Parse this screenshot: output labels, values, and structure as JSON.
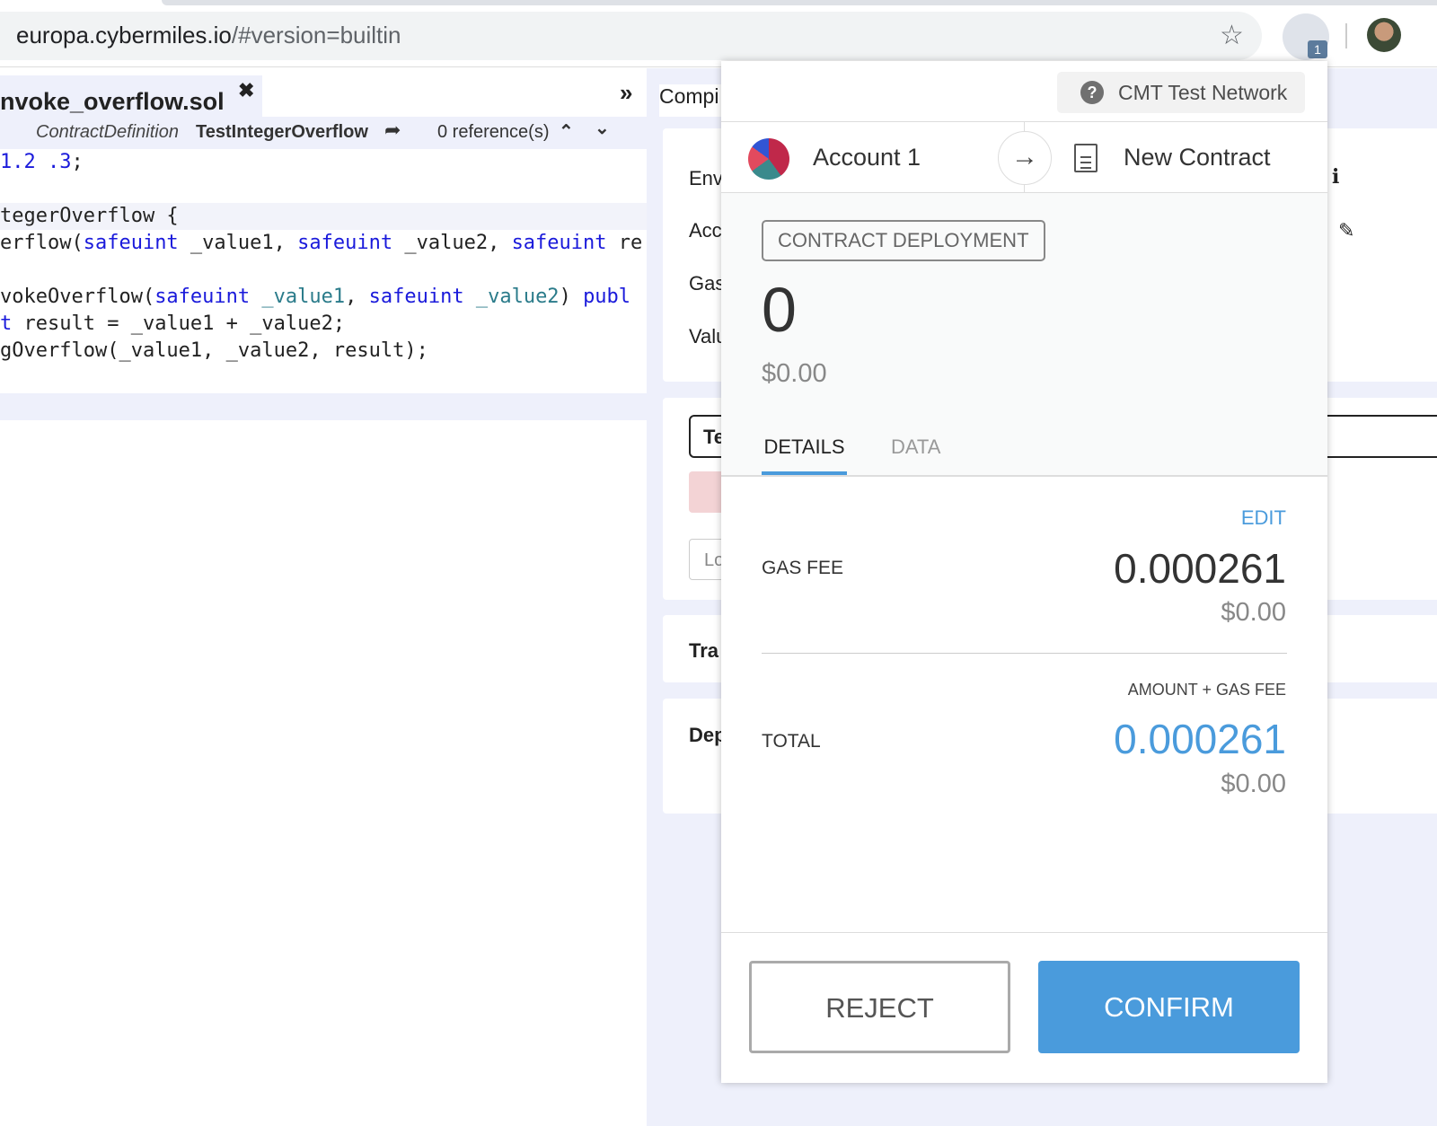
{
  "browser": {
    "url_host": "europa.cybermiles.io",
    "url_path": "/#version=builtin",
    "extension_badge": "1"
  },
  "editor": {
    "filename": "nvoke_overflow.sol",
    "close": "✖",
    "collapse": "»",
    "def_kind": "ContractDefinition",
    "def_name": "TestIntegerOverflow",
    "references": "0 reference(s)",
    "code": [
      {
        "parts": [
          [
            "kw",
            "1.2 .3"
          ],
          [
            "",
            "; "
          ]
        ]
      },
      {
        "parts": []
      },
      {
        "parts": [
          [
            "",
            "tegerOverflow {"
          ]
        ]
      },
      {
        "parts": [
          [
            "",
            "erflow("
          ],
          [
            "kw",
            "safeuint"
          ],
          [
            "",
            " _value1, "
          ],
          [
            "kw",
            "safeuint"
          ],
          [
            "",
            " _value2, "
          ],
          [
            "kw",
            "safeuint"
          ],
          [
            "",
            " re"
          ]
        ]
      },
      {
        "parts": []
      },
      {
        "parts": [
          [
            "",
            "vokeOverflow("
          ],
          [
            "kw",
            "safeuint"
          ],
          [
            "vr",
            " _value1"
          ],
          [
            "",
            ", "
          ],
          [
            "kw",
            "safeuint"
          ],
          [
            "vr",
            " _value2"
          ],
          [
            "",
            ") "
          ],
          [
            "kw",
            "publ"
          ]
        ]
      },
      {
        "parts": [
          [
            "kw",
            "t"
          ],
          [
            "",
            " result = _value1 + _value2;"
          ]
        ]
      },
      {
        "parts": [
          [
            "",
            "gOverflow(_value1, _value2, result);"
          ]
        ]
      }
    ]
  },
  "right_panel": {
    "tab": "Compi",
    "labels": [
      "Env",
      "Acc",
      "Gas",
      "Valu"
    ],
    "te": "Te",
    "lo": "Lo",
    "tra": "Tra",
    "dep": "Dep",
    "info": "i"
  },
  "popup": {
    "network": "CMT Test Network",
    "network_icon": "?",
    "account": "Account 1",
    "arrow": "→",
    "recipient": "New Contract",
    "tag": "CONTRACT DEPLOYMENT",
    "amount": "0",
    "amount_usd": "$0.00",
    "tabs": [
      "DETAILS",
      "DATA"
    ],
    "edit": "EDIT",
    "gas_fee_label": "GAS FEE",
    "gas_fee": "0.000261",
    "gas_fee_usd": "$0.00",
    "total_caption": "AMOUNT + GAS FEE",
    "total_label": "TOTAL",
    "total": "0.000261",
    "total_usd": "$0.00",
    "reject": "REJECT",
    "confirm": "CONFIRM"
  },
  "colors": {
    "accent": "#4a9bdc",
    "keyword": "#1a1adb"
  }
}
